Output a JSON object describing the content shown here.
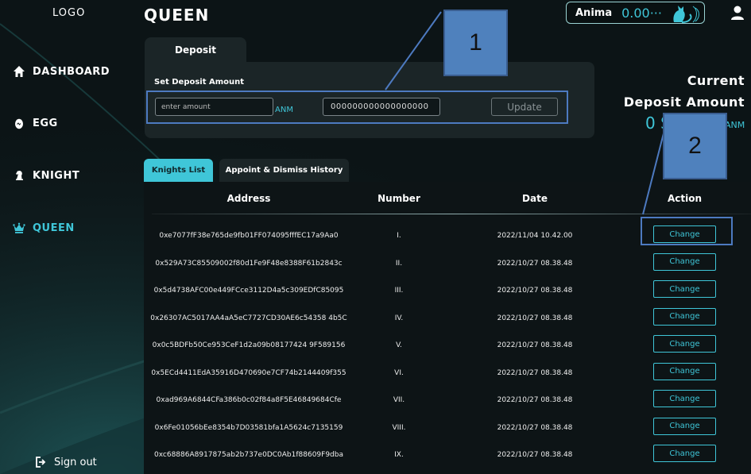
{
  "sidebar": {
    "logo": "LOGO",
    "items": [
      {
        "label": "DASHBOARD",
        "icon": "home-icon"
      },
      {
        "label": "EGG",
        "icon": "egg-icon"
      },
      {
        "label": "KNIGHT",
        "icon": "knight-icon"
      },
      {
        "label": "QUEEN",
        "icon": "crown-icon",
        "active": true
      }
    ],
    "sign_out": "Sign out"
  },
  "header": {
    "title": "QUEEN",
    "wallet_name": "Anima",
    "wallet_balance": "0.00···"
  },
  "deposit": {
    "tab_label": "Deposit",
    "section_label": "Set Deposit Amount",
    "amount_placeholder": "enter amount",
    "unit": "ANM",
    "current_value": "000000000000000000",
    "update_label": "Update"
  },
  "current_deposit": {
    "line1": "Current",
    "line2": "Deposit Amount",
    "value": "0 S",
    "unit": "ANM"
  },
  "callouts": [
    "1",
    "2"
  ],
  "tabs": [
    "Knights List",
    "Appoint & Dismiss History"
  ],
  "table": {
    "headers": [
      "Address",
      "Number",
      "Date",
      "Action"
    ],
    "action_label": "Change",
    "rows": [
      {
        "address": "0xe7077fF38e765de9fb01FF074095fffEC17a9Aa0",
        "number": "I.",
        "date": "2022/11/04 10.42.00"
      },
      {
        "address": "0x529A73C85509002f80d1Fe9F48e8388F61b2843c",
        "number": "II.",
        "date": "2022/10/27 08.38.48"
      },
      {
        "address": "0x5d4738AFC00e449FCce3112D4a5c309EDfC85095",
        "number": "III.",
        "date": "2022/10/27 08.38.48"
      },
      {
        "address": "0x26307AC5017AA4aA5eC7727CD30AE6c54358 4b5C",
        "number": "IV.",
        "date": "2022/10/27 08.38.48"
      },
      {
        "address": "0x0c5BDFb50Ce953CeF1d2a09b08177424 9F589156",
        "number": "V.",
        "date": "2022/10/27 08.38.48"
      },
      {
        "address": "0x5ECd4411EdA35916D470690e7CF74b2144409f355",
        "number": "VI.",
        "date": "2022/10/27 08.38.48"
      },
      {
        "address": "0xad969A6844CFa386b0c02f84a8F5E46849684Cfe",
        "number": "VII.",
        "date": "2022/10/27 08.38.48"
      },
      {
        "address": "0x6Fe01056bEe8354b7D03581bfa1A5624c7135159",
        "number": "VIII.",
        "date": "2022/10/27 08.38.48"
      },
      {
        "address": "0xc68886A8917875ab2b737e0DC0Ab1f88609F9dba",
        "number": "IX.",
        "date": "2022/10/27 08.38.48"
      }
    ]
  },
  "colors": {
    "accent": "#3fc6d8",
    "panel": "#1b2527",
    "background": "#0c1416",
    "callout": "#4f81bd"
  }
}
